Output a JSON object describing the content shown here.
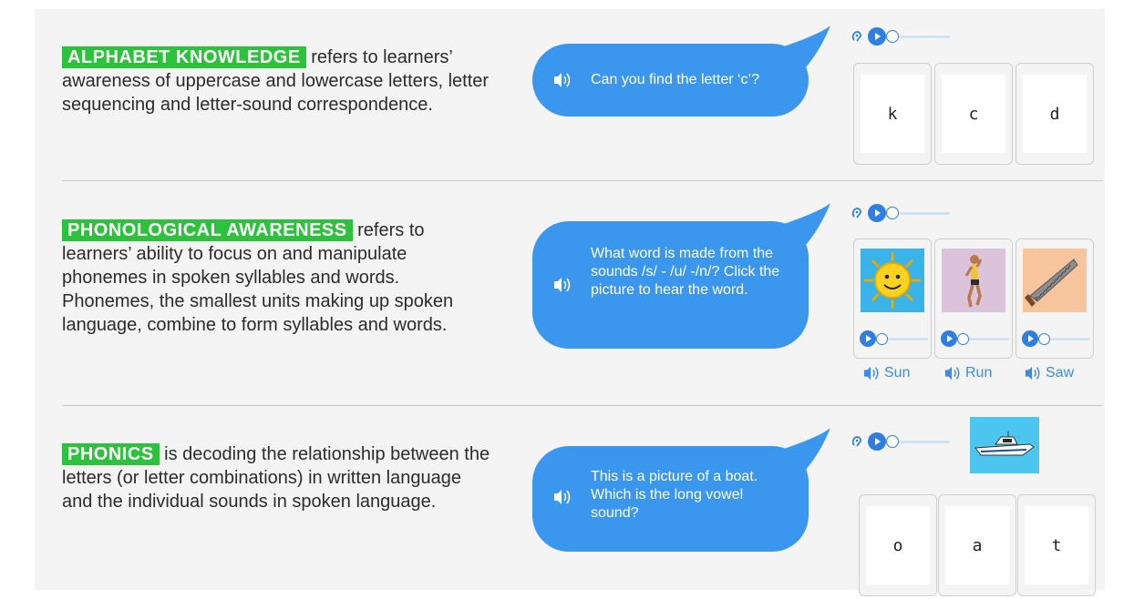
{
  "colors": {
    "highlight": "#2cc23b",
    "bubble": "#3b96ee",
    "accent": "#2f7fe0",
    "panel_bg": "#f5f4f5",
    "word_link": "#3b8be8"
  },
  "sections": [
    {
      "term": "ALPHABET KNOWLEDGE",
      "description": " refers to learners’ awareness of uppercase and lowercase letters, letter sequencing and letter-sound correspondence.",
      "prompt": "Can you find the letter ‘c’?",
      "options": [
        "k",
        "c",
        "d"
      ]
    },
    {
      "term": "PHONOLOGICAL AWARENESS",
      "description": " refers to learners’ ability to focus on and manipulate phonemes in spoken syllables and words. Phonemes, the smallest units making up spoken language, combine to form syllables and words.",
      "prompt": "What word is made from the sounds /s/ - /u/ -/n/? Click the picture to hear the word.",
      "words": [
        "Sun",
        "Run",
        "Saw"
      ]
    },
    {
      "term": "PHONICS",
      "description": " is decoding the relationship between the letters (or letter combinations) in written language and the individual sounds in spoken language.",
      "prompt": "This is a picture of a boat. Which is the long vowel sound?",
      "options": [
        "o",
        "a",
        "t"
      ]
    }
  ],
  "icons": {
    "speaker": "speaker-icon",
    "ear": "ear-icon",
    "play": "play-icon"
  }
}
